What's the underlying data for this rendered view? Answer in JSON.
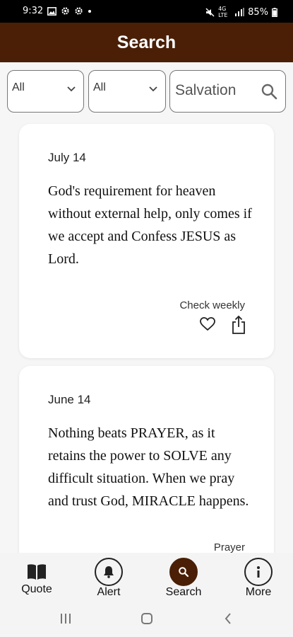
{
  "status_bar": {
    "time": "9:32",
    "network": "4G LTE",
    "battery": "85%",
    "icons": [
      "image-icon",
      "gear-icon",
      "gear-icon",
      "dot-icon",
      "mute-icon",
      "signal-icon",
      "battery-icon"
    ]
  },
  "app_bar": {
    "title": "Search"
  },
  "filters": {
    "category": {
      "value": "All"
    },
    "type": {
      "value": "All"
    },
    "search": {
      "value": "Salvation"
    }
  },
  "cards": [
    {
      "date": "July 14",
      "quote": "God's requirement for heaven without external help, only comes if we accept and Confess JESUS as Lord.",
      "category": "Check weekly"
    },
    {
      "date": "June 14",
      "quote": "Nothing beats PRAYER, as it retains the power to SOLVE any difficult situation. When we pray and trust God, MIRACLE happens.",
      "category": "Prayer"
    }
  ],
  "bottom_nav": {
    "items": [
      {
        "label": "Quote",
        "icon": "book-icon"
      },
      {
        "label": "Alert",
        "icon": "bell-icon"
      },
      {
        "label": "Search",
        "icon": "search-icon",
        "active": true
      },
      {
        "label": "More",
        "icon": "info-icon"
      }
    ]
  },
  "colors": {
    "brand": "#4a1f06",
    "background": "#f6f6f6"
  }
}
